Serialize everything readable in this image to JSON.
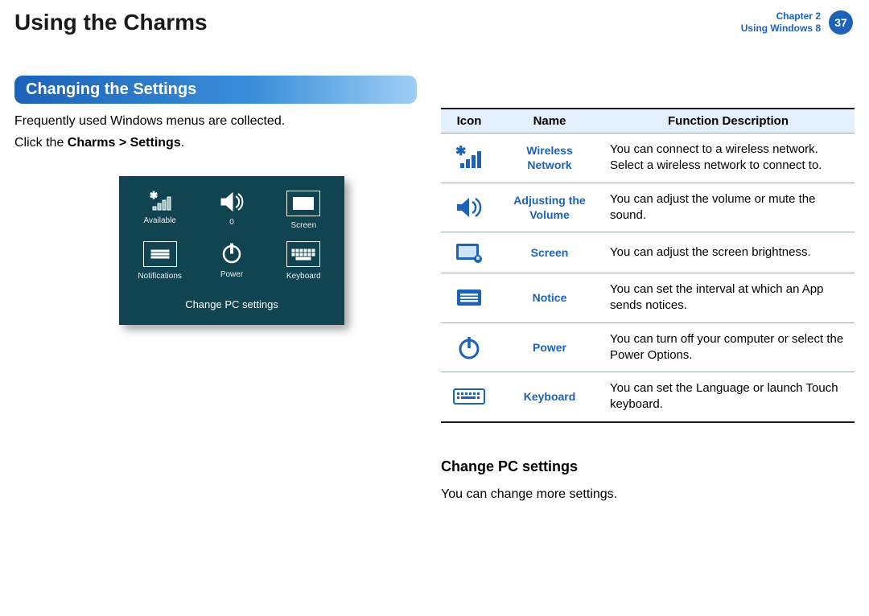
{
  "header": {
    "title": "Using the Charms",
    "chapter_line1": "Chapter 2",
    "chapter_line2": "Using Windows 8",
    "page_number": "37"
  },
  "section_bar": "Changing the Settings",
  "intro_line1": "Frequently used Windows menus are collected.",
  "intro_line2_prefix": "Click the ",
  "intro_line2_bold": "Charms > Settings",
  "intro_line2_suffix": ".",
  "panel": {
    "tiles": [
      {
        "label": "Available",
        "icon": "wifi"
      },
      {
        "label": "0",
        "icon": "volume"
      },
      {
        "label": "Screen",
        "icon": "screen"
      },
      {
        "label": "Notifications",
        "icon": "notice"
      },
      {
        "label": "Power",
        "icon": "power"
      },
      {
        "label": "Keyboard",
        "icon": "keyboard"
      }
    ],
    "footer": "Change PC settings"
  },
  "table": {
    "headers": {
      "icon": "Icon",
      "name": "Name",
      "desc": "Function Description"
    },
    "rows": [
      {
        "icon": "wifi",
        "name": "Wireless Network",
        "desc": "You can connect to a wireless network. Select a wireless network to connect to."
      },
      {
        "icon": "volume",
        "name": "Adjusting the Volume",
        "desc": "You can adjust the volume or mute the sound."
      },
      {
        "icon": "screen",
        "name": "Screen",
        "desc": "You can adjust the screen brightness."
      },
      {
        "icon": "notice",
        "name": "Notice",
        "desc": "You can set the interval at which an App sends notices."
      },
      {
        "icon": "power",
        "name": "Power",
        "desc": "You can turn off your computer or select the Power Options."
      },
      {
        "icon": "keyboard",
        "name": "Keyboard",
        "desc": "You can set the Language or launch Touch keyboard."
      }
    ]
  },
  "sub_heading": "Change PC settings",
  "sub_body": "You can change more settings."
}
